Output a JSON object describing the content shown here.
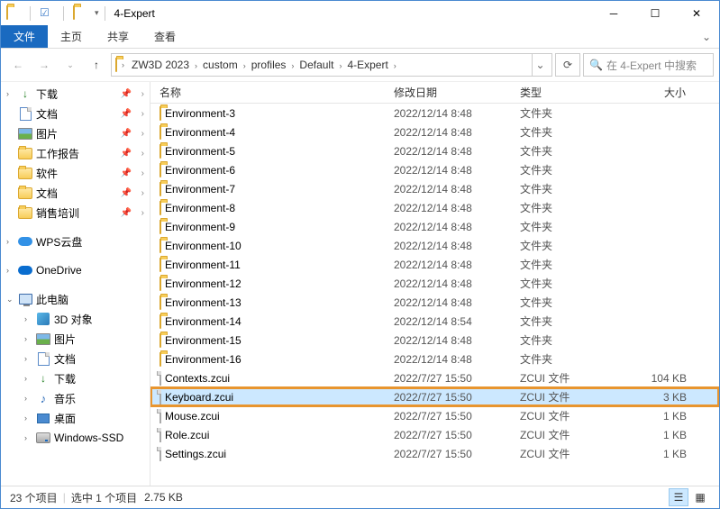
{
  "title": "4-Expert",
  "menu": {
    "file": "文件",
    "home": "主页",
    "share": "共享",
    "view": "查看"
  },
  "breadcrumb": [
    "ZW3D 2023",
    "custom",
    "profiles",
    "Default",
    "4-Expert"
  ],
  "search_placeholder": "在 4-Expert 中搜索",
  "columns": {
    "name": "名称",
    "modified": "修改日期",
    "type": "类型",
    "size": "大小"
  },
  "sidebar": [
    {
      "label": "下载",
      "icon": "dl",
      "pin": true,
      "expand": ">"
    },
    {
      "label": "文档",
      "icon": "doc",
      "pin": true
    },
    {
      "label": "图片",
      "icon": "img",
      "pin": true
    },
    {
      "label": "工作报告",
      "icon": "folder",
      "pin": true
    },
    {
      "label": "软件",
      "icon": "folder",
      "pin": true
    },
    {
      "label": "文档",
      "icon": "folder",
      "pin": true
    },
    {
      "label": "销售培训",
      "icon": "folder",
      "pin": true
    },
    {
      "gap": true
    },
    {
      "label": "WPS云盘",
      "icon": "wps",
      "expand": ">"
    },
    {
      "gap": true
    },
    {
      "label": "OneDrive",
      "icon": "od",
      "expand": ">"
    },
    {
      "gap": true
    },
    {
      "label": "此电脑",
      "icon": "pc",
      "expand": "v"
    },
    {
      "label": "3D 对象",
      "icon": "cube",
      "indent": true,
      "expand": ">"
    },
    {
      "label": "图片",
      "icon": "img",
      "indent": true,
      "expand": ">"
    },
    {
      "label": "文档",
      "icon": "doc",
      "indent": true,
      "expand": ">"
    },
    {
      "label": "下载",
      "icon": "dl",
      "indent": true,
      "expand": ">"
    },
    {
      "label": "音乐",
      "icon": "music",
      "indent": true,
      "expand": ">"
    },
    {
      "label": "桌面",
      "icon": "desktop",
      "indent": true,
      "expand": ">"
    },
    {
      "label": "Windows-SSD",
      "icon": "diskwin",
      "indent": true,
      "expand": ">"
    }
  ],
  "files": [
    {
      "name": "Environment-3",
      "date": "2022/12/14 8:48",
      "type": "文件夹",
      "size": "",
      "icon": "folder"
    },
    {
      "name": "Environment-4",
      "date": "2022/12/14 8:48",
      "type": "文件夹",
      "size": "",
      "icon": "folder"
    },
    {
      "name": "Environment-5",
      "date": "2022/12/14 8:48",
      "type": "文件夹",
      "size": "",
      "icon": "folder"
    },
    {
      "name": "Environment-6",
      "date": "2022/12/14 8:48",
      "type": "文件夹",
      "size": "",
      "icon": "folder"
    },
    {
      "name": "Environment-7",
      "date": "2022/12/14 8:48",
      "type": "文件夹",
      "size": "",
      "icon": "folder"
    },
    {
      "name": "Environment-8",
      "date": "2022/12/14 8:48",
      "type": "文件夹",
      "size": "",
      "icon": "folder"
    },
    {
      "name": "Environment-9",
      "date": "2022/12/14 8:48",
      "type": "文件夹",
      "size": "",
      "icon": "folder"
    },
    {
      "name": "Environment-10",
      "date": "2022/12/14 8:48",
      "type": "文件夹",
      "size": "",
      "icon": "folder"
    },
    {
      "name": "Environment-11",
      "date": "2022/12/14 8:48",
      "type": "文件夹",
      "size": "",
      "icon": "folder"
    },
    {
      "name": "Environment-12",
      "date": "2022/12/14 8:48",
      "type": "文件夹",
      "size": "",
      "icon": "folder"
    },
    {
      "name": "Environment-13",
      "date": "2022/12/14 8:48",
      "type": "文件夹",
      "size": "",
      "icon": "folder"
    },
    {
      "name": "Environment-14",
      "date": "2022/12/14 8:54",
      "type": "文件夹",
      "size": "",
      "icon": "folder"
    },
    {
      "name": "Environment-15",
      "date": "2022/12/14 8:48",
      "type": "文件夹",
      "size": "",
      "icon": "folder"
    },
    {
      "name": "Environment-16",
      "date": "2022/12/14 8:48",
      "type": "文件夹",
      "size": "",
      "icon": "folder"
    },
    {
      "name": "Contexts.zcui",
      "date": "2022/7/27 15:50",
      "type": "ZCUI 文件",
      "size": "104 KB",
      "icon": "file"
    },
    {
      "name": "Keyboard.zcui",
      "date": "2022/7/27 15:50",
      "type": "ZCUI 文件",
      "size": "3 KB",
      "icon": "file",
      "selected": true,
      "highlighted": true
    },
    {
      "name": "Mouse.zcui",
      "date": "2022/7/27 15:50",
      "type": "ZCUI 文件",
      "size": "1 KB",
      "icon": "file"
    },
    {
      "name": "Role.zcui",
      "date": "2022/7/27 15:50",
      "type": "ZCUI 文件",
      "size": "1 KB",
      "icon": "file"
    },
    {
      "name": "Settings.zcui",
      "date": "2022/7/27 15:50",
      "type": "ZCUI 文件",
      "size": "1 KB",
      "icon": "file"
    }
  ],
  "status": {
    "count": "23 个项目",
    "sel": "选中 1 个项目",
    "size": "2.75 KB"
  }
}
